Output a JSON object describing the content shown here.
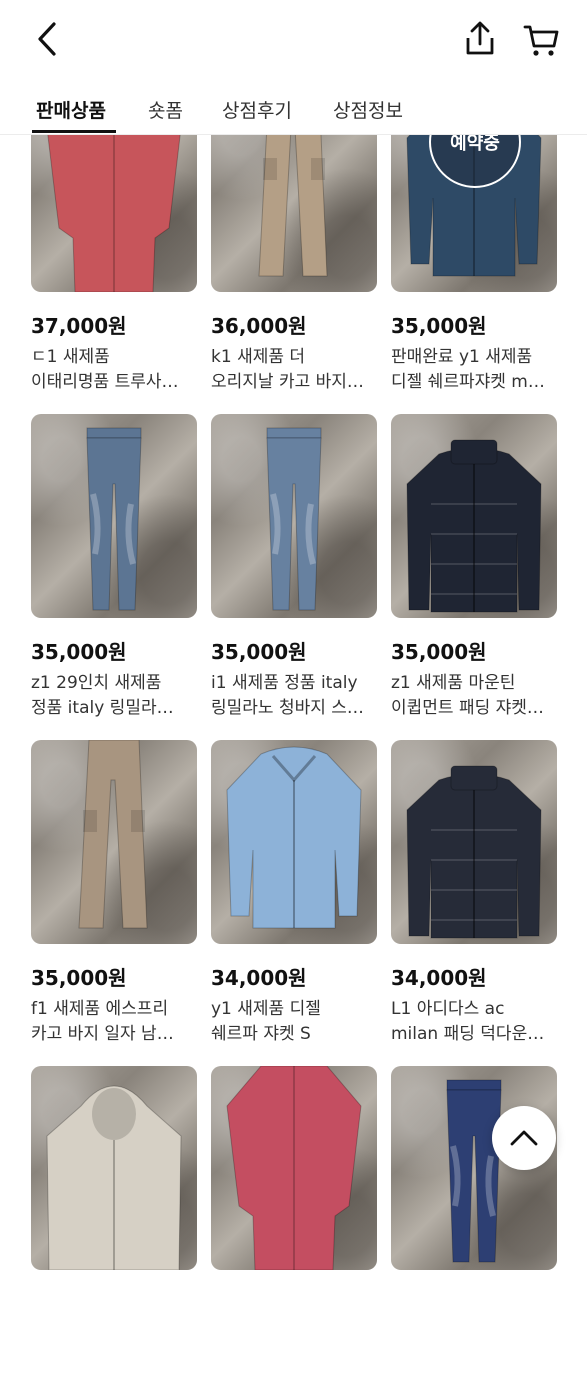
{
  "header": {
    "back_icon": "chevron-left-icon",
    "share_icon": "share-icon",
    "cart_icon": "cart-icon"
  },
  "tabs": [
    {
      "label": "판매상품",
      "active": true
    },
    {
      "label": "숏폼"
    },
    {
      "label": "상점후기"
    },
    {
      "label": "상점정보"
    }
  ],
  "products": [
    {
      "price": "37,000원",
      "line1": "ㄷ1 새제품",
      "line2": "이태리명품 트루사…",
      "garment": "shirt",
      "color": "#c7555b"
    },
    {
      "price": "36,000원",
      "line1": "k1 새제품 더",
      "line2": "오리지날 카고 바지…",
      "garment": "pants",
      "color": "#b49f86"
    },
    {
      "price": "35,000원",
      "line1": "판매완료 y1 새제품",
      "line2": "디젤 쉐르파쟈켓 m…",
      "garment": "jacket",
      "color": "#2e4a66",
      "badge": "예약중"
    },
    {
      "price": "35,000원",
      "line1": "z1 29인치 새제품",
      "line2": "정품 italy 링밀라…",
      "garment": "jeans",
      "color": "#5c7593"
    },
    {
      "price": "35,000원",
      "line1": "i1 새제품 정품 italy",
      "line2": "링밀라노 청바지 스…",
      "garment": "jeans",
      "color": "#6781a0"
    },
    {
      "price": "35,000원",
      "line1": "z1 새제품 마운틴",
      "line2": "이큅먼트 패딩 쟈켓…",
      "garment": "puffer",
      "color": "#1f2533"
    },
    {
      "price": "35,000원",
      "line1": "f1 새제품 에스프리",
      "line2": "카고 바지 일자 남…",
      "garment": "pants",
      "color": "#a89580"
    },
    {
      "price": "34,000원",
      "line1": "y1 새제품 디젤",
      "line2": "쉐르파 쟈켓 S",
      "garment": "jacket",
      "color": "#8db2d8"
    },
    {
      "price": "34,000원",
      "line1": "L1 아디다스 ac",
      "line2": "milan 패딩 덕다운…",
      "garment": "puffer",
      "color": "#262b38"
    },
    {
      "price": "",
      "line1": "",
      "line2": "",
      "garment": "hoodie",
      "color": "#d6d0c5"
    },
    {
      "price": "",
      "line1": "",
      "line2": "",
      "garment": "shirt",
      "color": "#c44e61"
    },
    {
      "price": "",
      "line1": "",
      "line2": "",
      "garment": "jeans",
      "color": "#2d3f73"
    }
  ],
  "scroll_top_icon": "chevron-up-icon"
}
